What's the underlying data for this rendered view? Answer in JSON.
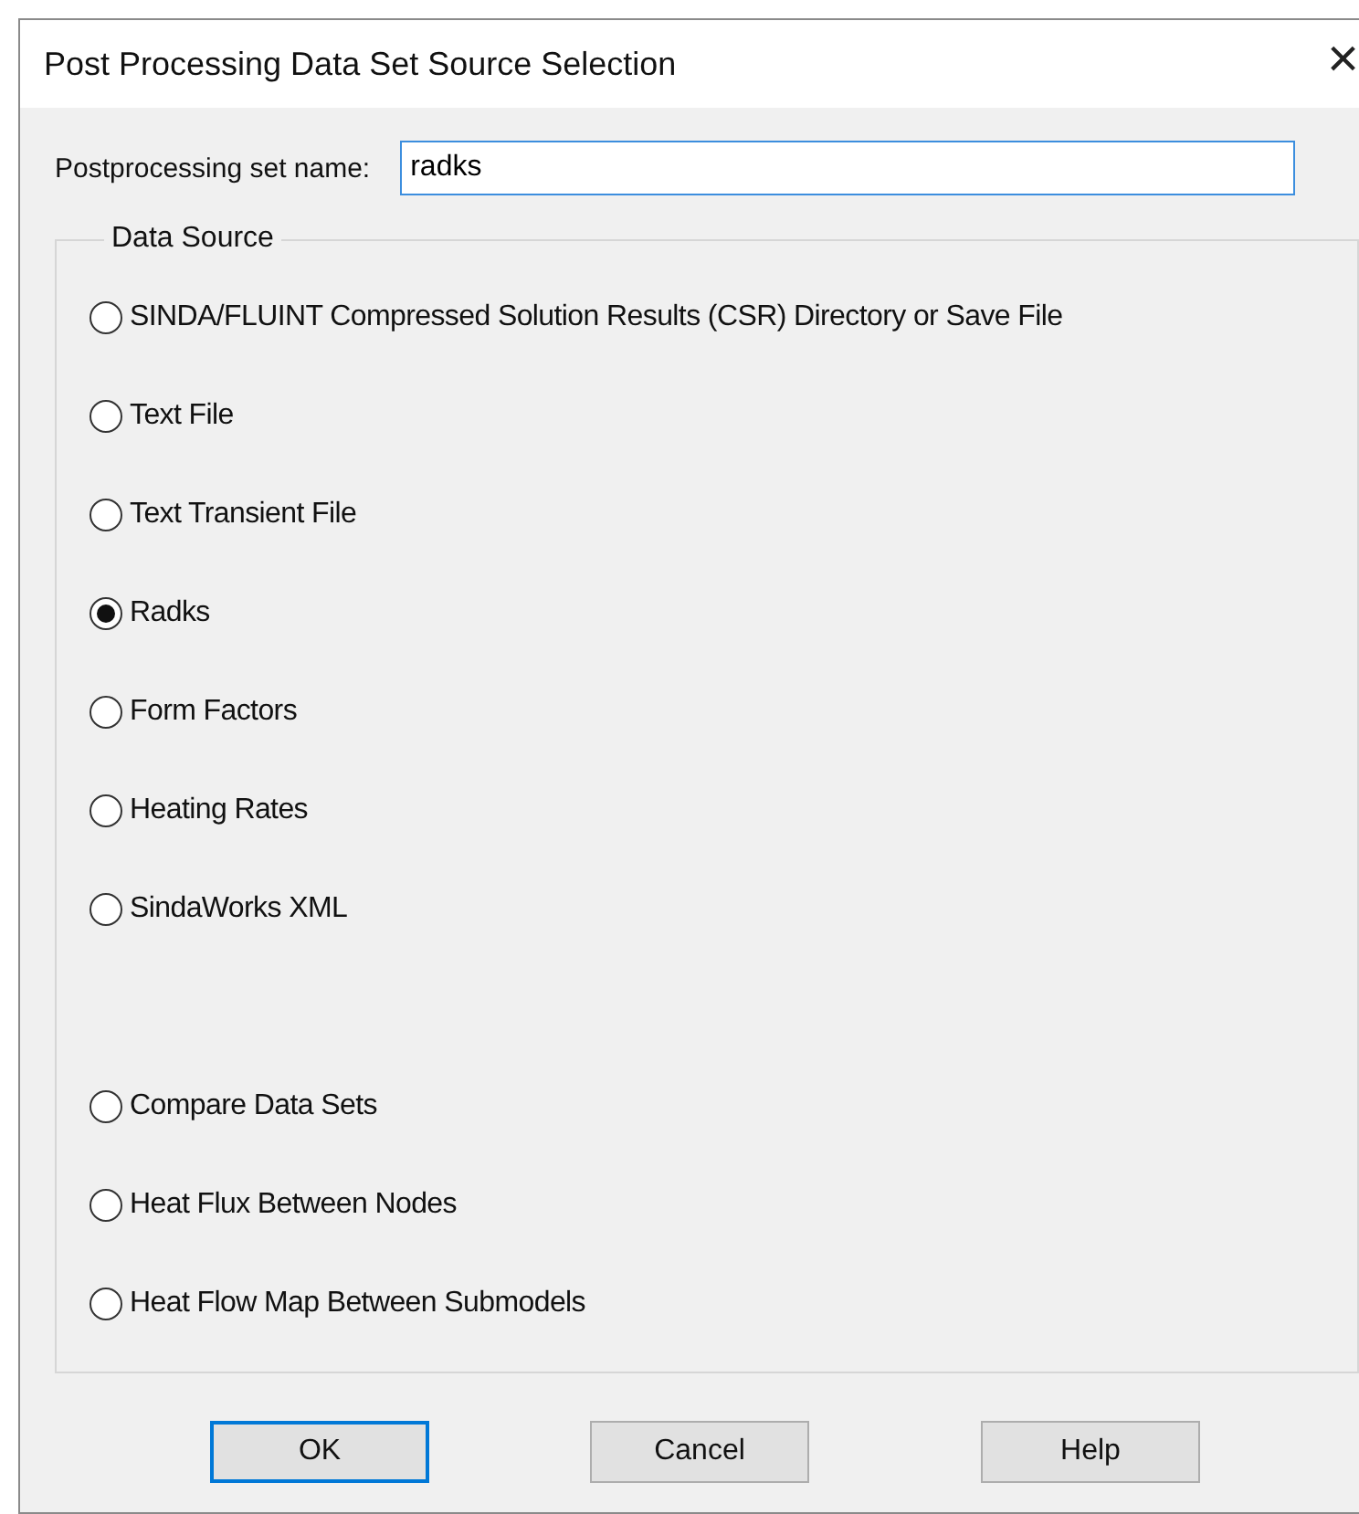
{
  "window": {
    "title": "Post Processing Data Set Source Selection",
    "close": "×"
  },
  "set_name": {
    "label": "Postprocessing set name:",
    "value": "radks"
  },
  "data_source": {
    "legend": "Data Source",
    "options": [
      {
        "label": "SINDA/FLUINT Compressed Solution Results (CSR) Directory or Save File",
        "selected": false
      },
      {
        "label": "Text File",
        "selected": false
      },
      {
        "label": "Text Transient File",
        "selected": false
      },
      {
        "label": "Radks",
        "selected": true
      },
      {
        "label": "Form Factors",
        "selected": false
      },
      {
        "label": "Heating Rates",
        "selected": false
      },
      {
        "label": "SindaWorks XML",
        "selected": false
      }
    ],
    "more_options": [
      {
        "label": "Compare Data Sets",
        "selected": false
      },
      {
        "label": "Heat Flux Between Nodes",
        "selected": false
      },
      {
        "label": "Heat Flow Map Between Submodels",
        "selected": false
      }
    ]
  },
  "buttons": [
    {
      "label": "OK",
      "default": true
    },
    {
      "label": "Cancel",
      "default": false
    },
    {
      "label": "Help",
      "default": false
    }
  ]
}
